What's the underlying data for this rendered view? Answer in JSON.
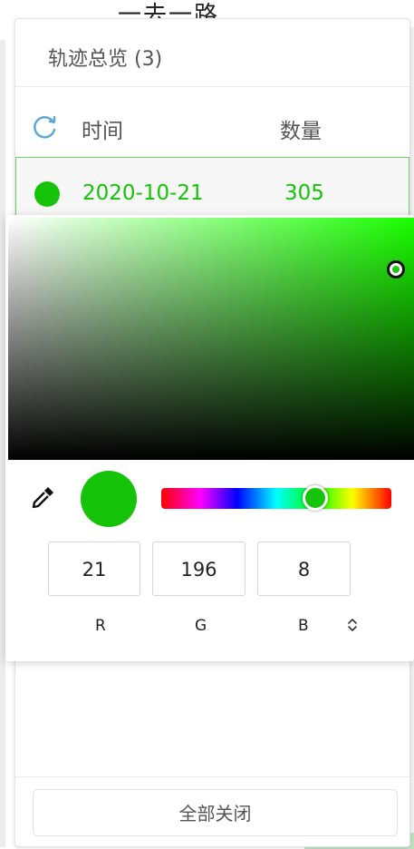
{
  "map": {
    "road_label": "一去一路"
  },
  "panel": {
    "title": "轨迹总览 (3)",
    "header": {
      "time_label": "时间",
      "count_label": "数量"
    },
    "rows": [
      {
        "date": "2020-10-21",
        "count": "305",
        "color": "#15c408"
      }
    ],
    "close_all_label": "全部关闭"
  },
  "color_picker": {
    "hue_color": "#1aff00",
    "selected_color": "#15c408",
    "hue_position": 0.63,
    "rgb": {
      "r": "21",
      "g": "196",
      "b": "8"
    },
    "labels": {
      "r": "R",
      "g": "G",
      "b": "B"
    },
    "mode_toggle_icon": "up-down-chevron-icon",
    "mode_toggle_glyph": "⌃⌄"
  }
}
